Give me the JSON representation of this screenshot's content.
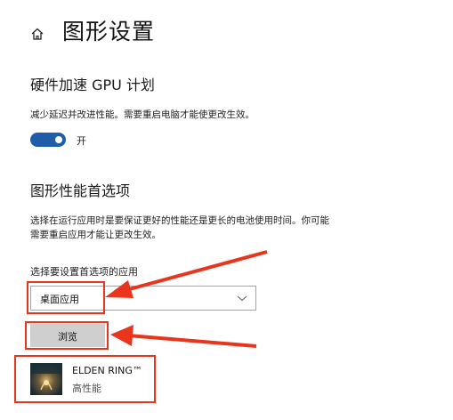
{
  "header": {
    "title": "图形设置",
    "home_icon": "home-icon"
  },
  "gpu_scheduling": {
    "title": "硬件加速 GPU 计划",
    "description": "减少延迟并改进性能。需要重启电脑才能使更改生效。",
    "toggle_state": "开",
    "toggle_on": true
  },
  "graphics_pref": {
    "title": "图形性能首选项",
    "description_line1": "选择在运行应用时是要保证更好的性能还是更长的电池使用时间。你可能",
    "description_line2": "需要重启应用才能让更改生效。",
    "select_label": "选择要设置首选项的应用",
    "select_value": "桌面应用",
    "browse_label": "浏览"
  },
  "apps": [
    {
      "name": "ELDEN RING™",
      "preference": "高性能"
    }
  ],
  "colors": {
    "accent": "#1f5da8",
    "annotation": "#e8351c",
    "button_bg": "#cfcfcf"
  }
}
